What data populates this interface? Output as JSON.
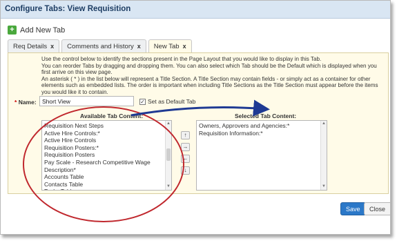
{
  "dialog": {
    "title": "Configure Tabs: View Requisition",
    "add_tab_label": "Add New Tab",
    "tabs": [
      {
        "label": "Req Details",
        "close": "x"
      },
      {
        "label": "Comments and History",
        "close": "x"
      },
      {
        "label": "New Tab",
        "close": "x"
      }
    ],
    "instructions": [
      "Use the control below to identify the sections present in the Page Layout that you would like to display in this Tab.",
      "You can reorder Tabs by dragging and dropping them. You can also select which Tab should be the Default which is displayed when you first arrive on this view page.",
      "An asterisk ( * ) in the list below will represent a Title Section. A Title Section may contain fields - or simply act as a container for other elements such as embedded lists. The order is important when including Title Sections as the Title Section must appear before the items you would like it to contain."
    ],
    "name_label": "Name:",
    "name_required_marker": "*",
    "name_value": "Short View",
    "default_checkbox_label": "Set as Default Tab",
    "default_checked": true,
    "available_title": "Available Tab Content:",
    "available_items": [
      "Requisition Next Steps",
      "Active Hire Controls:*",
      "Active Hire Controls",
      "Requisition Posters:*",
      "Requisition Posters",
      "Pay Scale - Research Competitive Wage",
      "Description*",
      "Accounts Table",
      "Contacts Table",
      "Tasks Table"
    ],
    "selected_title": "Selected Tab Content:",
    "selected_items": [
      "Owners, Approvers and Agencies:*",
      "Requisition Information:*"
    ],
    "move_buttons": {
      "up": "↑",
      "right": "→",
      "left": "←",
      "down": "↓"
    },
    "save_label": "Save",
    "close_label": "Close"
  },
  "colors": {
    "titlebar": "#d9e6f3",
    "panel": "#fffbe8",
    "annotation_ellipse": "#c0272d",
    "annotation_arrow": "#1f3a93",
    "save_button": "#2b78c8"
  }
}
